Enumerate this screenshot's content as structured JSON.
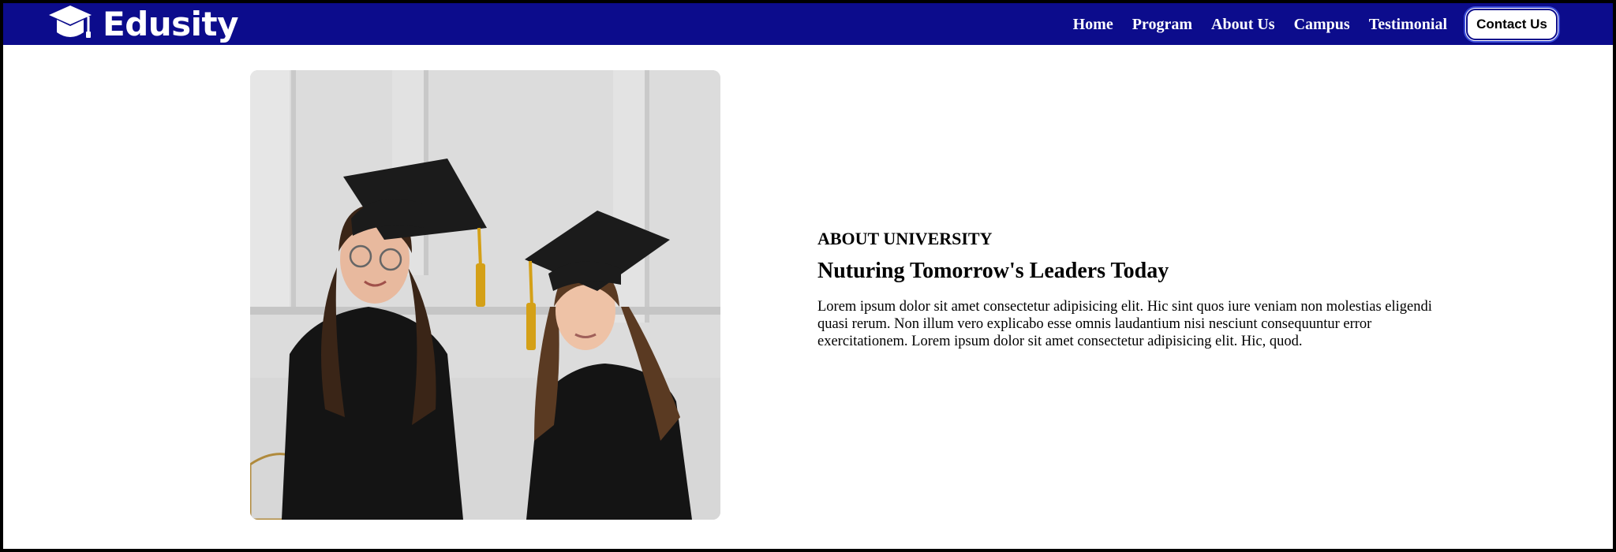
{
  "brand": {
    "name": "Edusity",
    "icon": "graduation-cap-icon"
  },
  "nav": {
    "links": [
      "Home",
      "Program",
      "About Us",
      "Campus",
      "Testimonial"
    ],
    "cta_label": "Contact Us"
  },
  "about": {
    "tag": "ABOUT UNIVERSITY",
    "title": "Nuturing Tomorrow's Leaders Today",
    "body": "Lorem ipsum dolor sit amet consectetur adipisicing elit. Hic sint quos iure veniam non molestias eligendi quasi rerum. Non illum vero explicabo esse omnis laudantium nisi nesciunt consequuntur error exercitationem. Lorem ipsum dolor sit amet consectetur adipisicing elit. Hic, quod."
  },
  "colors": {
    "nav_bg": "#0c0c8c",
    "text": "#000000",
    "page_bg": "#ffffff"
  }
}
